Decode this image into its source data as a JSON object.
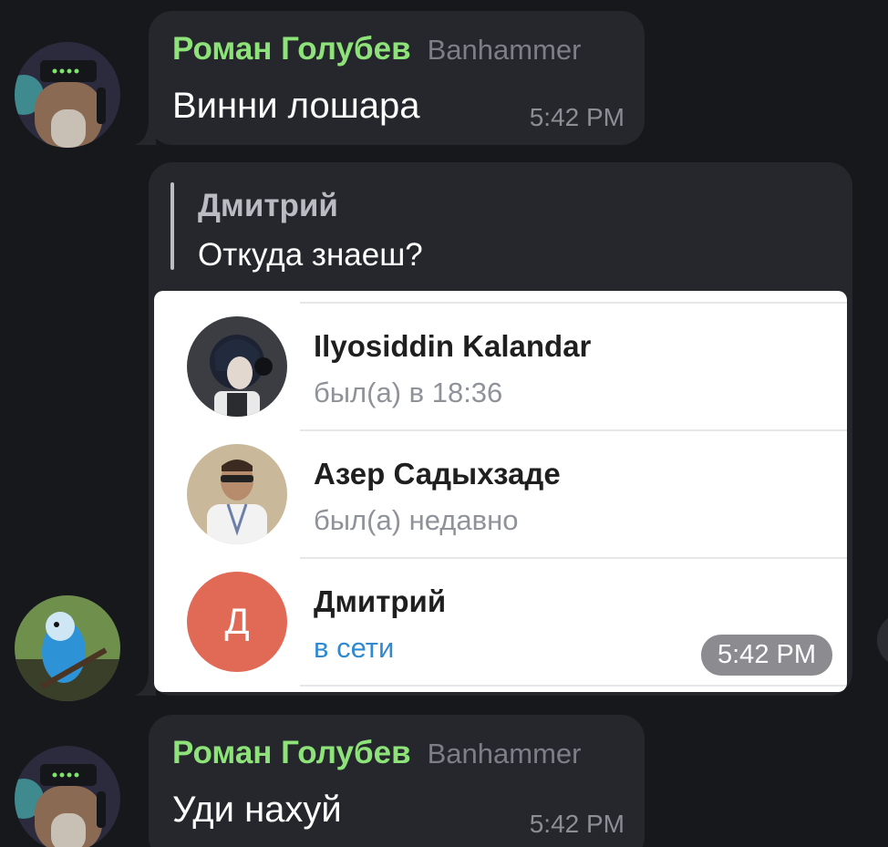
{
  "messages": [
    {
      "sender": "Роман Голубев",
      "badge": "Banhammer",
      "text": "Винни лошара",
      "time": "5:42 PM"
    },
    {
      "reply": {
        "name": "Дмитрий",
        "text": "Откуда знаеш?"
      },
      "screenshot": {
        "contacts": [
          {
            "name": "Ilyosiddin Kalandar",
            "status": "был(а) в 18:36"
          },
          {
            "name": "Азер Садыхзаде",
            "status": "был(а) недавно"
          },
          {
            "name": "Дмитрий",
            "status": "в сети",
            "initial": "Д"
          }
        ]
      },
      "time": "5:42 PM"
    },
    {
      "sender": "Роман Голубев",
      "badge": "Banhammer",
      "text": "Уди нахуй",
      "time": "5:42 PM"
    }
  ],
  "colors": {
    "background": "#17181c",
    "bubble": "#25272c",
    "sender_name": "#8ee27a",
    "online_status": "#2f8ad1",
    "letter_avatar": "#e16a56"
  }
}
